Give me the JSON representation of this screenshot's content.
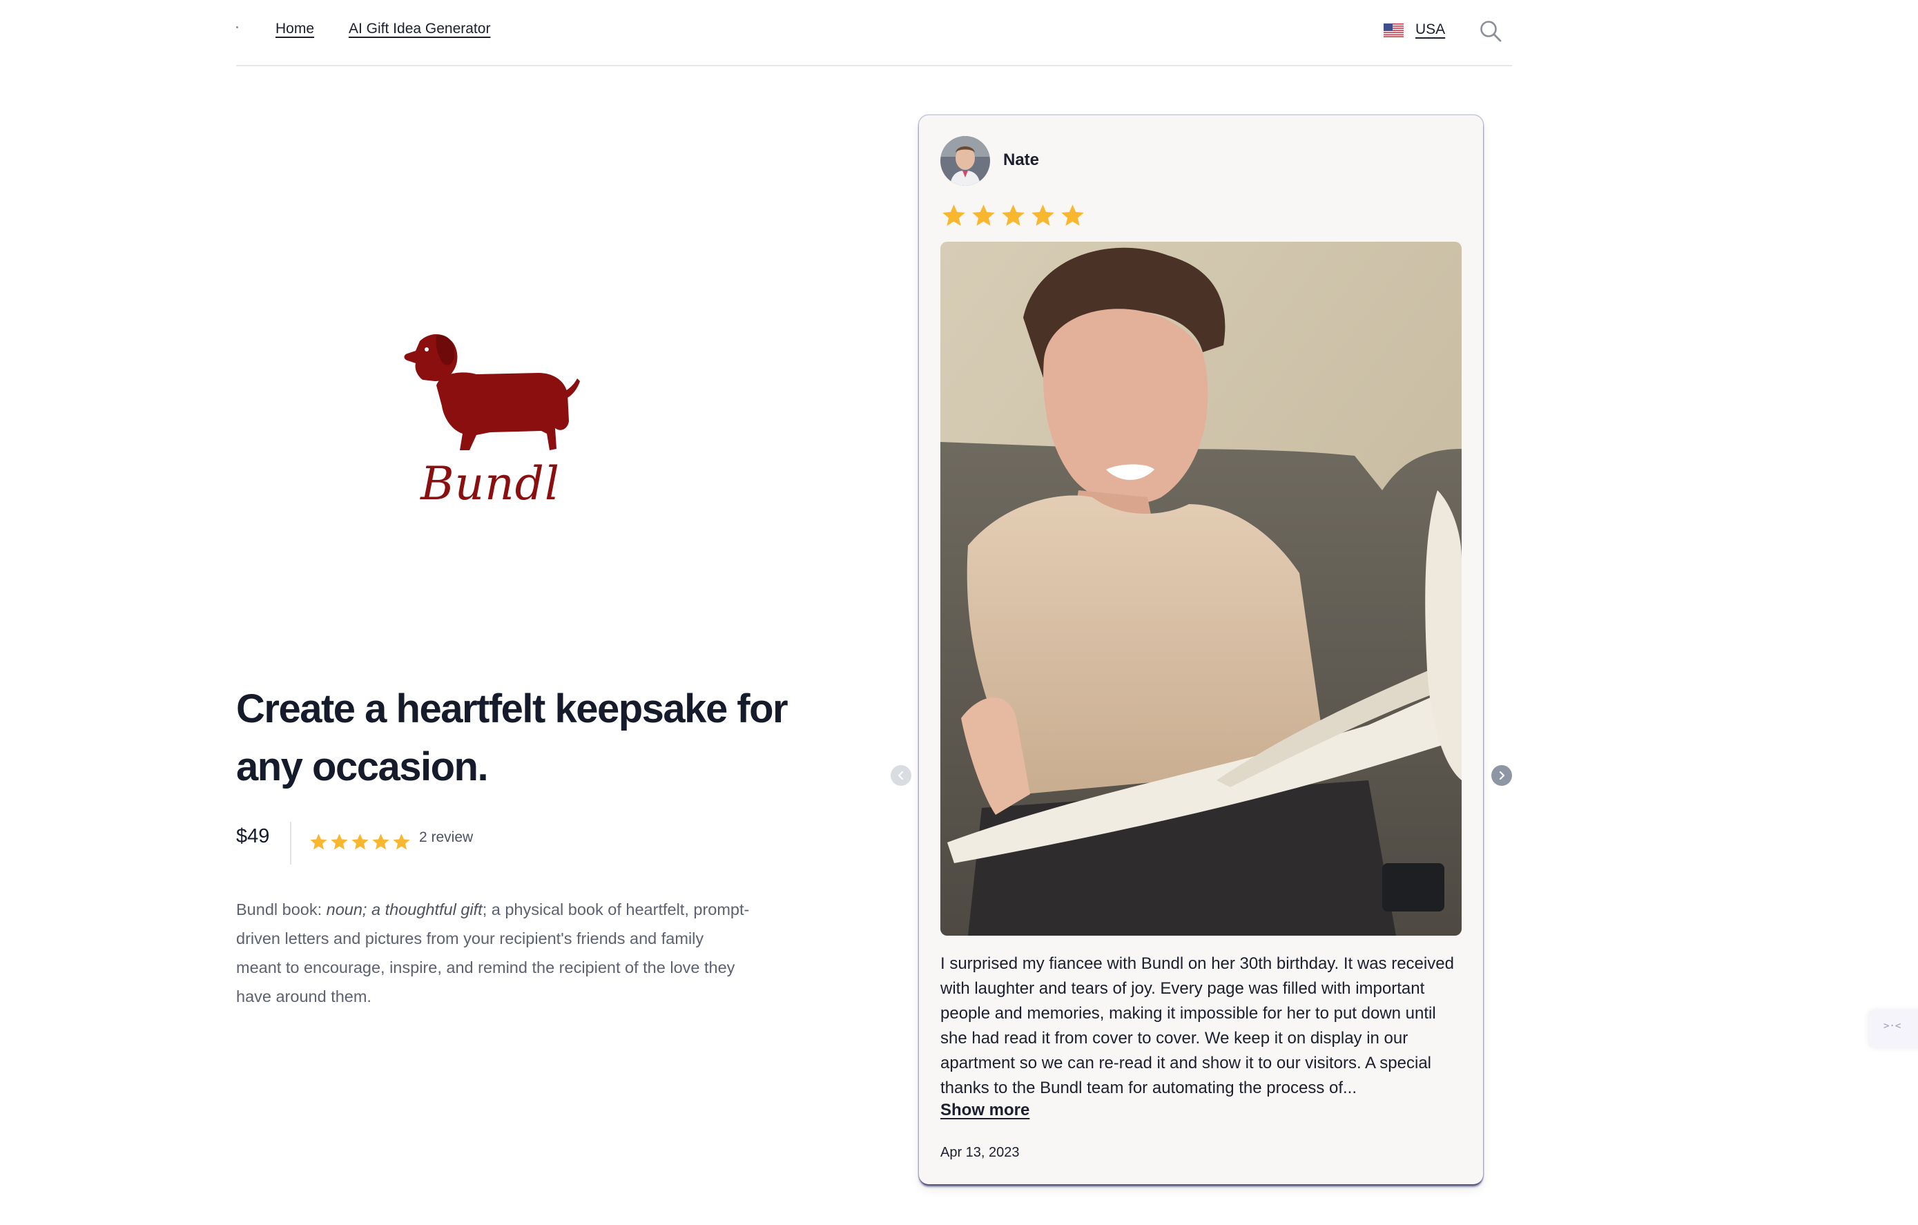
{
  "nav": {
    "links": [
      "Home",
      "AI Gift Idea Generator"
    ],
    "country": "USA",
    "flag_icon": "us-flag-icon",
    "search_icon": "search-icon"
  },
  "brand": {
    "name": "Bundl",
    "logo_icon": "dachshund-logo-icon",
    "color": "#8b0f0f"
  },
  "product": {
    "headline": "Create a heartfelt keepsake for any occasion.",
    "price": "$49",
    "rating": 5,
    "review_count": "2 review",
    "description_prefix": "Bundl book: ",
    "description_emphasis": "noun; a thoughtful gift",
    "description_rest": "; a physical book of heartfelt, prompt-driven letters and pictures from your recipient's friends and family meant to encourage, inspire, and remind the recipient of the love they have around them."
  },
  "review": {
    "name": "Nate",
    "rating": 5,
    "text": "I surprised my fiancee with Bundl on her 30th birthday. It was received with laughter and tears of joy. Every page was filled with important people and memories, making it impossible for her to put down until she had read it from cover to cover. We keep it on display in our apartment so we can re-read it and show it to our visitors. A special thanks to the Bundl team for automating the process of...",
    "show_more": "Show more",
    "date": "Apr 13, 2023"
  },
  "carousel": {
    "prev_icon": "chevron-left-icon",
    "next_icon": "chevron-right-icon"
  },
  "colors": {
    "star": "#f8b72e",
    "text": "#161b2c",
    "muted": "#5d6171",
    "card_bg": "#f8f7f5",
    "card_shadow": "#1a185a"
  }
}
